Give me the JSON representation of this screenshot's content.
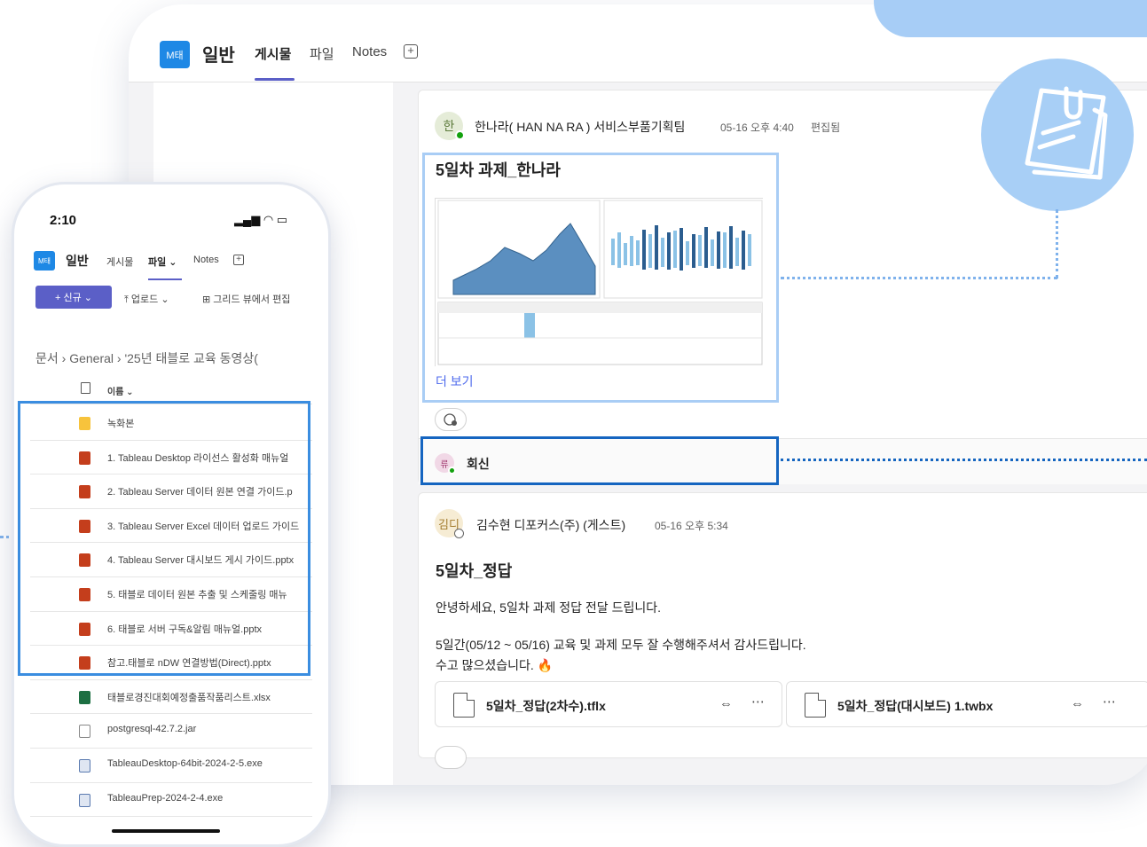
{
  "desktop": {
    "team_badge": "M태",
    "channel_name": "일반",
    "tabs": [
      {
        "label": "게시물"
      },
      {
        "label": "파일"
      },
      {
        "label": "Notes"
      }
    ],
    "add_tab_symbol": "+",
    "post1": {
      "avatar_text": "한",
      "author": "한나라( HAN NA RA ) 서비스부품기획팀",
      "meta": "05-16 오후 4:40",
      "edited": "편집됨",
      "title": "5일차 과제_한나라",
      "see_more": "더 보기",
      "reply_avatar": "류",
      "reply_label": "회신"
    },
    "post2": {
      "avatar_text": "김디",
      "author": "김수현 디포커스(주) (게스트)",
      "meta": "05-16 오후 5:34",
      "title": "5일차_정답",
      "line1": "안녕하세요, 5일차 과제 정답 전달 드립니다.",
      "line2": "5일간(05/12 ~ 05/16) 교육 및 과제 모두 잘 수행해주셔서 감사드립니다.",
      "line3": "수고 많으셨습니다. 🔥",
      "files": [
        {
          "name": "5일차_정답(2차수).tflx"
        },
        {
          "name": "5일차_정답(대시보드) 1.twbx"
        }
      ]
    },
    "colors": {
      "accent": "#5b5fc7",
      "highlight_light": "#a9cdf5",
      "highlight_dark": "#1565c0",
      "badge": "#1e88e5"
    }
  },
  "phone": {
    "time": "2:10",
    "team_badge": "M태",
    "channel_name": "일반",
    "tabs": [
      {
        "label": "게시물"
      },
      {
        "label": "파일 ⌄"
      },
      {
        "label": "Notes"
      }
    ],
    "add_tab_symbol": "+",
    "new_button": "+ 신규 ⌄",
    "upload": "⤒ 업로드 ⌄",
    "grid_edit": "⊞ 그리드 뷰에서 편집",
    "breadcrumb": "문서  ›  General  ›  '25년 태블로 교육 동영상(",
    "column_name": "이름 ⌄",
    "files": [
      {
        "name": "녹화본",
        "type": "folder"
      },
      {
        "name": "1. Tableau Desktop 라이선스 활성화 매뉴얼",
        "type": "ppt"
      },
      {
        "name": "2. Tableau Server 데이터 원본 연결 가이드.p",
        "type": "ppt"
      },
      {
        "name": "3. Tableau Server Excel 데이터 업로드 가이드",
        "type": "ppt"
      },
      {
        "name": "4. Tableau Server 대시보드 게시 가이드.pptx",
        "type": "ppt"
      },
      {
        "name": "5. 태블로 데이터 원본 추출 및 스케줄링 매뉴",
        "type": "ppt"
      },
      {
        "name": "6. 태블로 서버 구독&알림 매뉴얼.pptx",
        "type": "ppt"
      },
      {
        "name": "참고.태블로 nDW 연결방법(Direct).pptx",
        "type": "ppt"
      },
      {
        "name": "태블로경진대회예정출품작품리스트.xlsx",
        "type": "xls"
      },
      {
        "name": "postgresql-42.7.2.jar",
        "type": "jar"
      },
      {
        "name": "TableauDesktop-64bit-2024-2-5.exe",
        "type": "exe"
      },
      {
        "name": "TableauPrep-2024-2-4.exe",
        "type": "exe"
      }
    ]
  }
}
